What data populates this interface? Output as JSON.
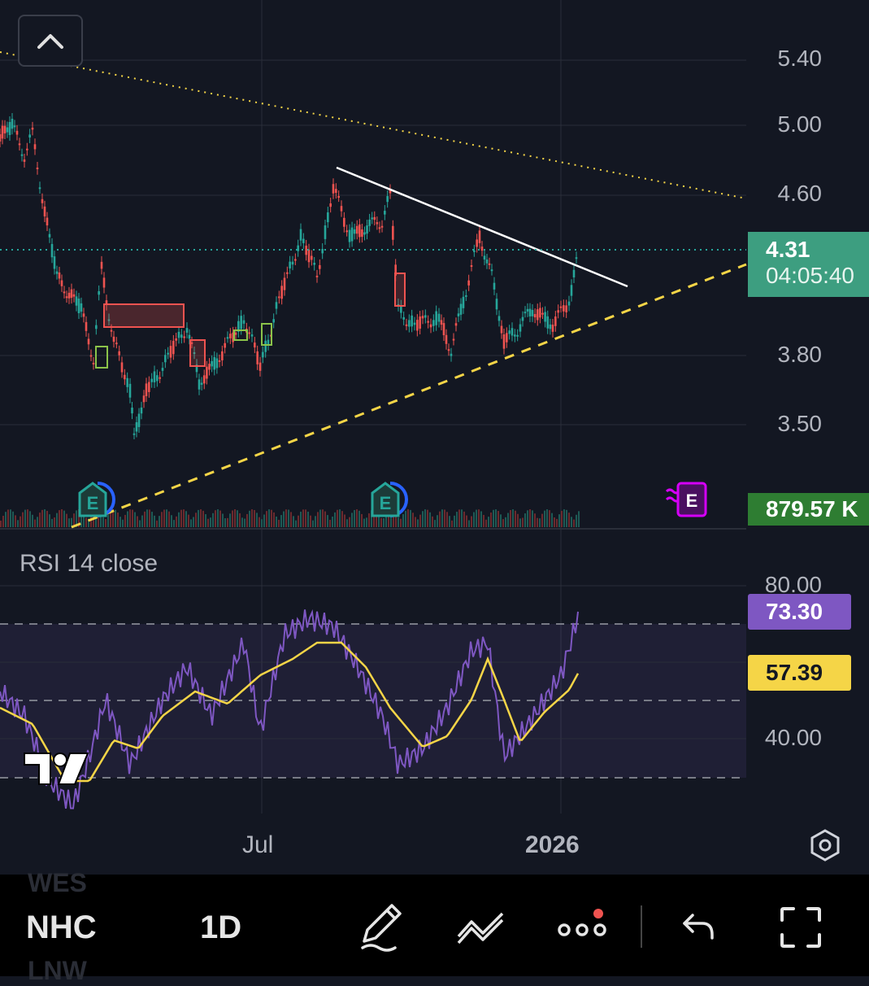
{
  "symbol": "NHC",
  "interval": "1D",
  "price_axis": {
    "labels": [
      "5.40",
      "5.00",
      "4.60",
      "3.80",
      "3.50"
    ]
  },
  "last_price": {
    "value": "4.31",
    "countdown": "04:05:40",
    "color": "#26a69a"
  },
  "volume_badge": {
    "value": "879.57 K",
    "color": "#1e7e34"
  },
  "rsi": {
    "title": "RSI 14 close",
    "axis_labels": [
      "80.00",
      "40.00"
    ],
    "value_badge": "73.30",
    "ma_badge": "57.39",
    "rsi_color": "#7e57c2",
    "ma_color": "#f5d547"
  },
  "x_axis": {
    "labels": [
      "Jul",
      "2026"
    ]
  },
  "earnings_marker_label": "E",
  "toolbar": {
    "icons": [
      "draw-pencil-icon",
      "indicators-icon",
      "more-icon",
      "undo-icon",
      "fullscreen-icon"
    ]
  },
  "colors": {
    "up": "#26a69a",
    "down": "#ef5350",
    "background": "#131722"
  }
}
